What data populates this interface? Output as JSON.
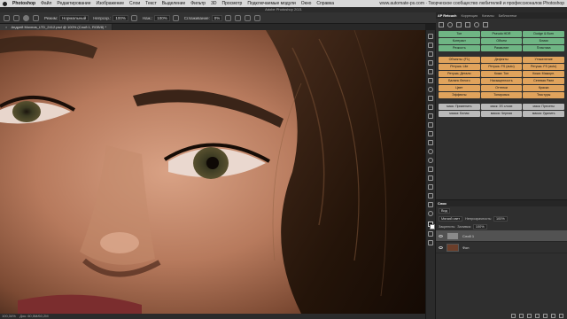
{
  "menubar": {
    "app": "Photoshop",
    "items": [
      "Файл",
      "Редактирование",
      "Изображение",
      "Слои",
      "Текст",
      "Выделение",
      "Фильтр",
      "3D",
      "Просмотр",
      "Подключаемые модули",
      "Окно",
      "Справка"
    ],
    "right_text": "www.automate-ps.com · Творческое сообщество любителей и профессионалов Photoshop"
  },
  "window_title": "Adobe Photoshop 2021",
  "options": {
    "mode_label": "Режим:",
    "mode_value": "Нормальный",
    "opacity_label": "Непрозр.:",
    "opacity_value": "100%",
    "flow_label": "Наж.:",
    "flow_value": "100%",
    "smoothing_label": "Сглаживание:",
    "smoothing_value": "0%"
  },
  "document_tab": {
    "close": "×",
    "title": "Андрей Мохнов_LTD_2412.psd @ 100% (Слой 1, RGB/8) *"
  },
  "status": {
    "zoom": "100,34%",
    "doc": "Док: 60,5М/60,2М"
  },
  "panel_tabs": [
    "AP Retouch",
    "Коррекция",
    "Каналы",
    "Библиотеки"
  ],
  "ap_buttons": [
    {
      "label": "Тон",
      "color": "#6fb584"
    },
    {
      "label": "Pseudo HDR",
      "color": "#6fb584"
    },
    {
      "label": "Dodge & Burn",
      "color": "#6fb584"
    },
    {
      "label": "Контраст",
      "color": "#6fb584"
    },
    {
      "label": "Объем",
      "color": "#6fb584"
    },
    {
      "label": "Блики",
      "color": "#6fb584"
    },
    {
      "label": "Резкость",
      "color": "#6fb584"
    },
    {
      "label": "Размытие",
      "color": "#6fb584"
    },
    {
      "label": "Пластика",
      "color": "#6fb584"
    },
    {
      "label": "Объекты: (F1)",
      "color": "#e0a35c"
    },
    {
      "label": "Дефекты",
      "color": "#e0a35c"
    },
    {
      "label": "Утяжеление",
      "color": "#e0a35c"
    },
    {
      "label": "Ретушь: Lite",
      "color": "#e0a35c"
    },
    {
      "label": "Ретушь: FS (auto)",
      "color": "#e0a35c"
    },
    {
      "label": "Ретушь: FS (auto)",
      "color": "#e0a35c"
    },
    {
      "label": "Ретушь: Детали",
      "color": "#e0a35c"
    },
    {
      "label": "Кожа: Тон",
      "color": "#e0a35c"
    },
    {
      "label": "Кожа: Мажорн.",
      "color": "#e0a35c"
    },
    {
      "label": "Баланс белого",
      "color": "#e0a35c"
    },
    {
      "label": "Насыщенность",
      "color": "#e0a35c"
    },
    {
      "label": "Сетевая Ранн",
      "color": "#e0a35c"
    },
    {
      "label": "Цвет",
      "color": "#e0a35c"
    },
    {
      "label": "Оттенки",
      "color": "#e0a35c"
    },
    {
      "label": "Краска",
      "color": "#e0a35c"
    },
    {
      "label": "Эффекты",
      "color": "#e0a35c"
    },
    {
      "label": "Тонировка",
      "color": "#e0a35c"
    },
    {
      "label": "Текстуры",
      "color": "#e0a35c"
    },
    {
      "label": "маск: Применить",
      "color": "#b9b9b9"
    },
    {
      "label": "маск: 3S слоях",
      "color": "#b9b9b9"
    },
    {
      "label": "маск: Пресеты",
      "color": "#b9b9b9"
    },
    {
      "label": "маска: Белая",
      "color": "#b9b9b9"
    },
    {
      "label": "маска: Черная",
      "color": "#b9b9b9"
    },
    {
      "label": "маска: Удалить",
      "color": "#b9b9b9"
    }
  ],
  "layers": {
    "tabs": [
      "Слои"
    ],
    "filter_label": "Вид",
    "blend": "Мягкий свет",
    "opacity_label": "Непрозрачность:",
    "opacity_value": "100%",
    "lock_label": "Закрепить:",
    "fill_label": "Заливка:",
    "fill_value": "100%",
    "items": [
      {
        "name": "Слой 1",
        "selected": true,
        "thumb": "#8a8a8a"
      },
      {
        "name": "Фон",
        "selected": false,
        "thumb": "#6b3e2a"
      }
    ]
  }
}
